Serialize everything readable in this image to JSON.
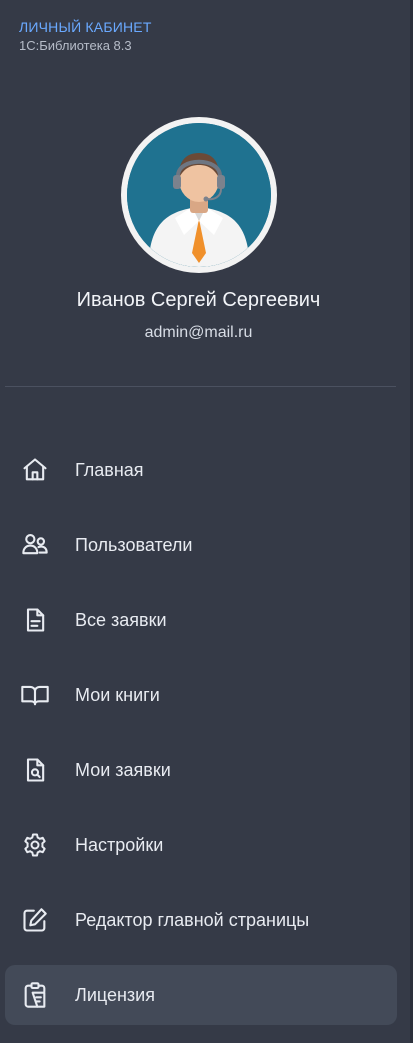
{
  "header": {
    "title": "ЛИЧНЫЙ КАБИНЕТ",
    "subtitle": "1С:Библиотека 8.3"
  },
  "profile": {
    "name": "Иванов Сергей Сергеевич",
    "email": "admin@mail.ru",
    "avatar_icon": "user-avatar-icon"
  },
  "menu": {
    "items": [
      {
        "label": "Главная",
        "icon": "home-icon",
        "active": false
      },
      {
        "label": "Пользователи",
        "icon": "users-icon",
        "active": false
      },
      {
        "label": "Все заявки",
        "icon": "document-icon",
        "active": false
      },
      {
        "label": "Мои книги",
        "icon": "book-icon",
        "active": false
      },
      {
        "label": "Мои заявки",
        "icon": "document-search-icon",
        "active": false
      },
      {
        "label": "Настройки",
        "icon": "gear-icon",
        "active": false
      },
      {
        "label": "Редактор главной страницы",
        "icon": "edit-icon",
        "active": false
      },
      {
        "label": "Лицензия",
        "icon": "clipboard-icon",
        "active": true
      }
    ]
  },
  "colors": {
    "background": "#353a47",
    "accent": "#6aa9ff",
    "active_item": "#434a58"
  }
}
